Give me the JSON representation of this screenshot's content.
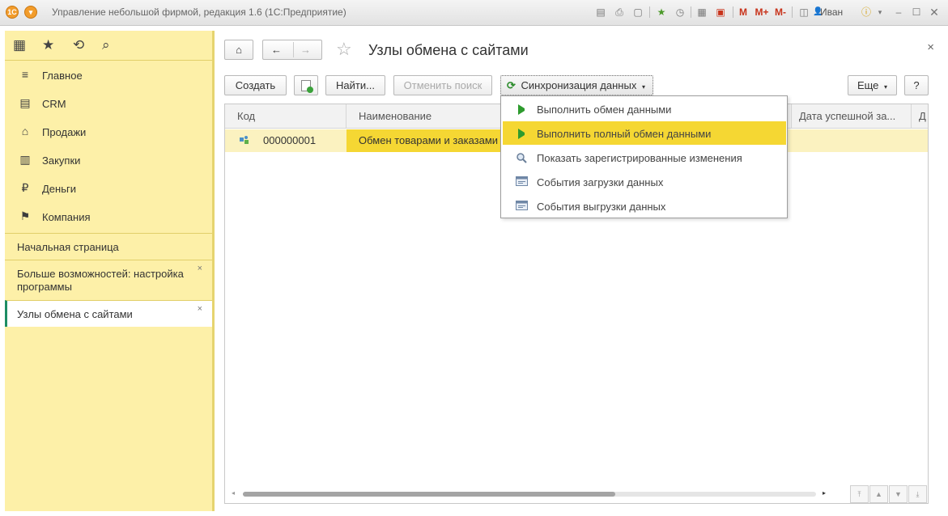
{
  "window": {
    "title": "Управление небольшой фирмой, редакция 1.6  (1С:Предприятие)",
    "user": "Иван",
    "memory_buttons": [
      "M",
      "M+",
      "M-"
    ]
  },
  "sidebar": {
    "sections": [
      {
        "icon": "menu-lines-icon",
        "label": "Главное"
      },
      {
        "icon": "crm-icon",
        "label": "CRM"
      },
      {
        "icon": "basket-icon",
        "label": "Продажи"
      },
      {
        "icon": "cart-icon",
        "label": "Закупки"
      },
      {
        "icon": "ruble-icon",
        "label": "Деньги"
      },
      {
        "icon": "flag-icon",
        "label": "Компания"
      }
    ],
    "open_windows": [
      {
        "label": "Начальная страница"
      },
      {
        "label": "Больше возможностей: настройка программы"
      },
      {
        "label": "Узлы обмена с сайтами"
      }
    ],
    "close_glyph": "×"
  },
  "form": {
    "title": "Узлы обмена с сайтами",
    "close": "×",
    "toolbar": {
      "create": "Создать",
      "find": "Найти...",
      "cancel_search": "Отменить поиск",
      "sync": "Синхронизация данных",
      "more": "Еще",
      "help": "?"
    }
  },
  "table": {
    "columns": [
      "Код",
      "Наименование",
      "Дата успешной за...",
      "Д"
    ],
    "rows": [
      {
        "code": "000000001",
        "name": "Обмен товарами и заказами"
      }
    ]
  },
  "sync_menu": {
    "items": [
      {
        "icon": "play-icon",
        "label": "Выполнить обмен данными"
      },
      {
        "icon": "play-icon",
        "label": "Выполнить полный обмен данными",
        "highlighted": true
      },
      {
        "icon": "magnifier-icon",
        "label": "Показать зарегистрированные изменения"
      },
      {
        "icon": "events-icon",
        "label": "События загрузки данных"
      },
      {
        "icon": "events-icon",
        "label": "События выгрузки данных"
      }
    ]
  }
}
